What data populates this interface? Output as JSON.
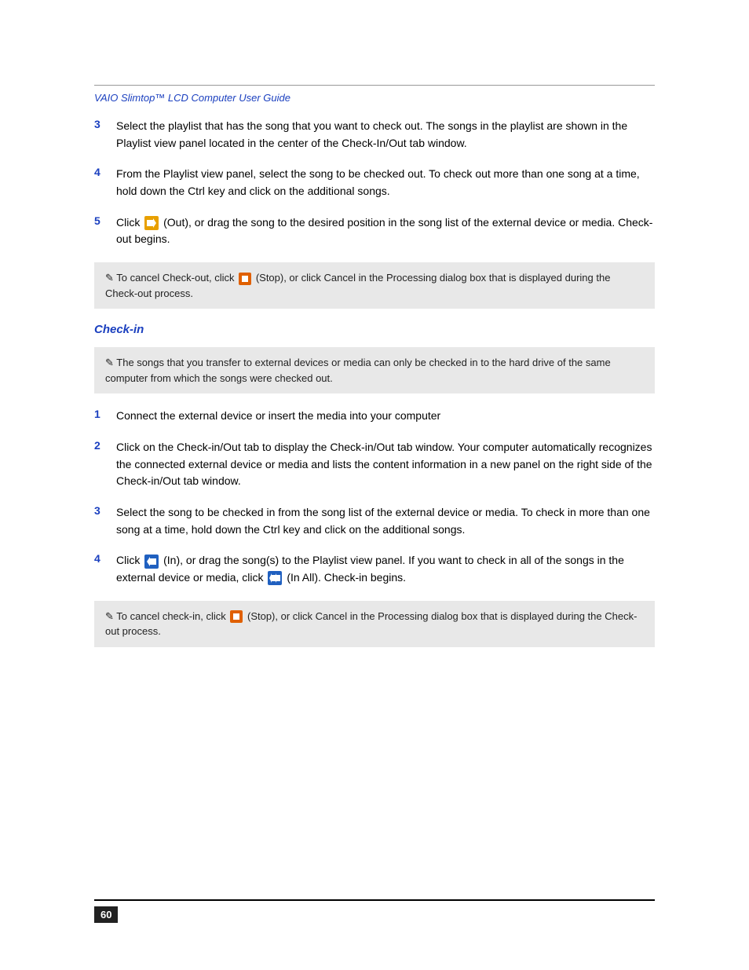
{
  "header": {
    "title": "VAIO Slimtop™ LCD Computer User Guide"
  },
  "steps_part1": [
    {
      "num": "3",
      "text": "Select the playlist that has the song that you want to check out. The songs in the playlist are shown in the Playlist view panel located in the center of the Check-In/Out tab window."
    },
    {
      "num": "4",
      "text": "From the Playlist view panel, select the song to be checked out. To check out more than one song at a time, hold down the Ctrl key and click on the additional songs."
    }
  ],
  "step5": {
    "num": "5",
    "text_before": "Click",
    "icon_out_label": "Out",
    "text_after": "(Out), or drag the song to the desired position in the song list of the external device or media. Check-out begins."
  },
  "note_checkout": {
    "prefix": "✎",
    "text": "To cancel Check-out, click",
    "icon_stop_label": "Stop",
    "text2": "(Stop), or click Cancel in the Processing dialog box that is displayed during the Check-out process."
  },
  "checkin_heading": "Check-in",
  "note_checkin_info": {
    "prefix": "✎",
    "text": "The songs that you transfer to external devices or media can only be checked in to the hard drive of the same computer from which the songs were checked out."
  },
  "steps_part2": [
    {
      "num": "1",
      "text": "Connect the external device or insert the media into your computer"
    },
    {
      "num": "2",
      "text": "Click on the Check-in/Out tab to display the Check-in/Out tab window. Your computer automatically recognizes the connected external device or media and lists the content information in a new panel on the right side of the Check-in/Out tab window."
    },
    {
      "num": "3",
      "text": "Select the song to be checked in from the song list of the external device or media. To check in more than one song at a time, hold down the Ctrl key and click on the additional songs."
    }
  ],
  "step4_checkin": {
    "num": "4",
    "text_before": "Click",
    "icon_in_label": "In",
    "text_middle": "(In), or drag the song(s) to the Playlist view panel. If you want to check in all of the songs in the external device or media, click",
    "icon_inall_label": "In All",
    "text_after": "(In All). Check-in begins."
  },
  "note_checkin_cancel": {
    "prefix": "✎",
    "text": "To cancel check-in, click",
    "icon_stop_label": "Stop",
    "text2": "(Stop), or click Cancel in the Processing dialog box that is displayed during the Check-out process."
  },
  "page_number": "60",
  "colors": {
    "link": "#1a3fbf",
    "heading": "#1a3fbf",
    "note_bg": "#e0e0e0",
    "page_num_bg": "#222"
  }
}
